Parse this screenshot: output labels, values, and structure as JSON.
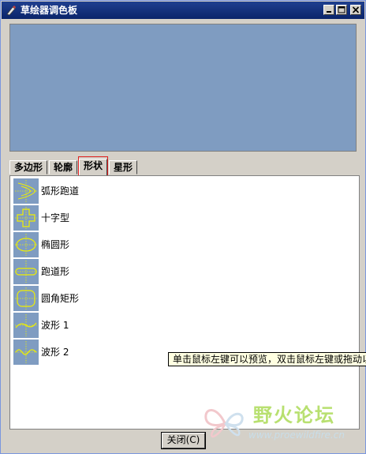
{
  "window": {
    "title": "草绘器调色板"
  },
  "tabs": [
    {
      "label": "多边形",
      "active": false
    },
    {
      "label": "轮廓",
      "active": false
    },
    {
      "label": "形状",
      "active": true
    },
    {
      "label": "星形",
      "active": false
    }
  ],
  "shapes": [
    {
      "label": "弧形跑道",
      "icon": "arc-track-icon"
    },
    {
      "label": "十字型",
      "icon": "cross-shape-icon"
    },
    {
      "label": "椭圆形",
      "icon": "ellipse-icon"
    },
    {
      "label": "跑道形",
      "icon": "racetrack-icon"
    },
    {
      "label": "圆角矩形",
      "icon": "rounded-rectangle-icon"
    },
    {
      "label": "波形 1",
      "icon": "wave-1-icon"
    },
    {
      "label": "波形 2",
      "icon": "wave-2-icon"
    }
  ],
  "tooltip": "单击鼠标左键可以预览，双击鼠标左键或拖动以",
  "close_button": "关闭(C)",
  "watermark": {
    "text": "野火论坛",
    "url": "www.proewildfire.cn"
  },
  "colors": {
    "preview_bg": "#7f9cc1",
    "shape_line": "#f0f000",
    "title_bar": "#0a246a"
  }
}
